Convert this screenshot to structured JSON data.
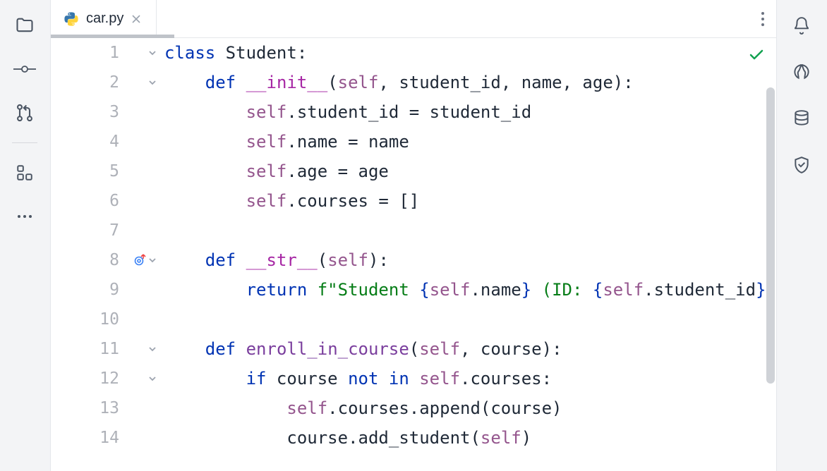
{
  "tab": {
    "filename": "car.py"
  },
  "code": {
    "lines": [
      {
        "n": 1,
        "fold": "down",
        "indent": 0,
        "tokens": [
          {
            "t": "kw",
            "v": "class"
          },
          {
            "t": "",
            "v": " Student:"
          }
        ]
      },
      {
        "n": 2,
        "fold": "down",
        "indent": 1,
        "tokens": [
          {
            "t": "kw",
            "v": "def"
          },
          {
            "t": "",
            "v": " "
          },
          {
            "t": "dunder",
            "v": "__init__"
          },
          {
            "t": "",
            "v": "("
          },
          {
            "t": "selfkw",
            "v": "self"
          },
          {
            "t": "",
            "v": ", student_id, name, age):"
          }
        ]
      },
      {
        "n": 3,
        "fold": "",
        "indent": 2,
        "tokens": [
          {
            "t": "selfkw",
            "v": "self"
          },
          {
            "t": "",
            "v": ".student_id = student_id"
          }
        ]
      },
      {
        "n": 4,
        "fold": "",
        "indent": 2,
        "tokens": [
          {
            "t": "selfkw",
            "v": "self"
          },
          {
            "t": "",
            "v": ".name = name"
          }
        ]
      },
      {
        "n": 5,
        "fold": "",
        "indent": 2,
        "tokens": [
          {
            "t": "selfkw",
            "v": "self"
          },
          {
            "t": "",
            "v": ".age = age"
          }
        ]
      },
      {
        "n": 6,
        "fold": "",
        "indent": 2,
        "tokens": [
          {
            "t": "selfkw",
            "v": "self"
          },
          {
            "t": "",
            "v": ".courses = []"
          }
        ]
      },
      {
        "n": 7,
        "fold": "",
        "indent": 0,
        "tokens": []
      },
      {
        "n": 8,
        "fold": "down",
        "target": true,
        "indent": 1,
        "tokens": [
          {
            "t": "kw",
            "v": "def"
          },
          {
            "t": "",
            "v": " "
          },
          {
            "t": "dunder",
            "v": "__str__"
          },
          {
            "t": "",
            "v": "("
          },
          {
            "t": "selfkw",
            "v": "self"
          },
          {
            "t": "",
            "v": "):"
          }
        ]
      },
      {
        "n": 9,
        "fold": "",
        "indent": 2,
        "tokens": [
          {
            "t": "kw",
            "v": "return"
          },
          {
            "t": "",
            "v": " "
          },
          {
            "t": "string",
            "v": "f\"Student "
          },
          {
            "t": "fstring-brace",
            "v": "{"
          },
          {
            "t": "selfkw",
            "v": "self"
          },
          {
            "t": "",
            "v": ".name"
          },
          {
            "t": "fstring-brace",
            "v": "}"
          },
          {
            "t": "string",
            "v": " (ID: "
          },
          {
            "t": "fstring-brace",
            "v": "{"
          },
          {
            "t": "selfkw",
            "v": "self"
          },
          {
            "t": "",
            "v": ".student_id"
          },
          {
            "t": "fstring-brace",
            "v": "}"
          },
          {
            "t": "string",
            "v": ","
          }
        ]
      },
      {
        "n": 10,
        "fold": "",
        "indent": 0,
        "tokens": []
      },
      {
        "n": 11,
        "fold": "down",
        "indent": 1,
        "tokens": [
          {
            "t": "kw",
            "v": "def"
          },
          {
            "t": "",
            "v": " "
          },
          {
            "t": "fname",
            "v": "enroll_in_course"
          },
          {
            "t": "",
            "v": "("
          },
          {
            "t": "selfkw",
            "v": "self"
          },
          {
            "t": "",
            "v": ", course):"
          }
        ]
      },
      {
        "n": 12,
        "fold": "down",
        "indent": 2,
        "tokens": [
          {
            "t": "kw",
            "v": "if"
          },
          {
            "t": "",
            "v": " course "
          },
          {
            "t": "kw",
            "v": "not in"
          },
          {
            "t": "",
            "v": " "
          },
          {
            "t": "selfkw",
            "v": "self"
          },
          {
            "t": "",
            "v": ".courses:"
          }
        ]
      },
      {
        "n": 13,
        "fold": "",
        "indent": 3,
        "tokens": [
          {
            "t": "selfkw",
            "v": "self"
          },
          {
            "t": "",
            "v": ".courses.append(course)"
          }
        ]
      },
      {
        "n": 14,
        "fold": "",
        "indent": 3,
        "tokens": [
          {
            "t": "",
            "v": "course.add_student("
          },
          {
            "t": "selfkw",
            "v": "self"
          },
          {
            "t": "",
            "v": ")"
          }
        ]
      }
    ]
  }
}
